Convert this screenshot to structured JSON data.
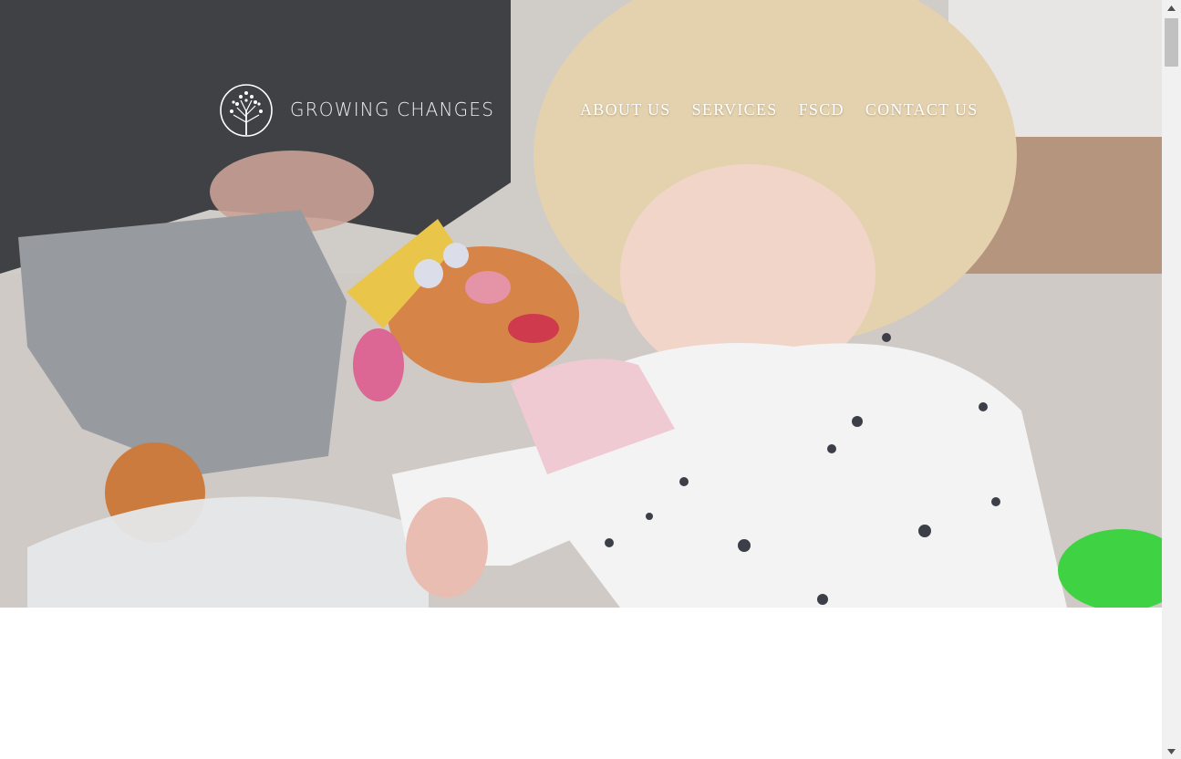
{
  "brand": {
    "name": "GROWING CHANGES",
    "logo_icon": "tree-in-circle-icon"
  },
  "nav": {
    "items": [
      {
        "label": "ABOUT US"
      },
      {
        "label": "SERVICES"
      },
      {
        "label": "FSCD"
      },
      {
        "label": "CONTACT US"
      }
    ]
  },
  "hero": {
    "image": "child-playing-with-toys-photo"
  },
  "scrollbar": {
    "up_icon": "arrow-up-icon",
    "down_icon": "arrow-down-icon"
  },
  "colors": {
    "nav_text": "#ffffff",
    "page_background": "#ffffff",
    "scrollbar_track": "#f1f1f1",
    "scrollbar_thumb": "#c1c1c1"
  }
}
